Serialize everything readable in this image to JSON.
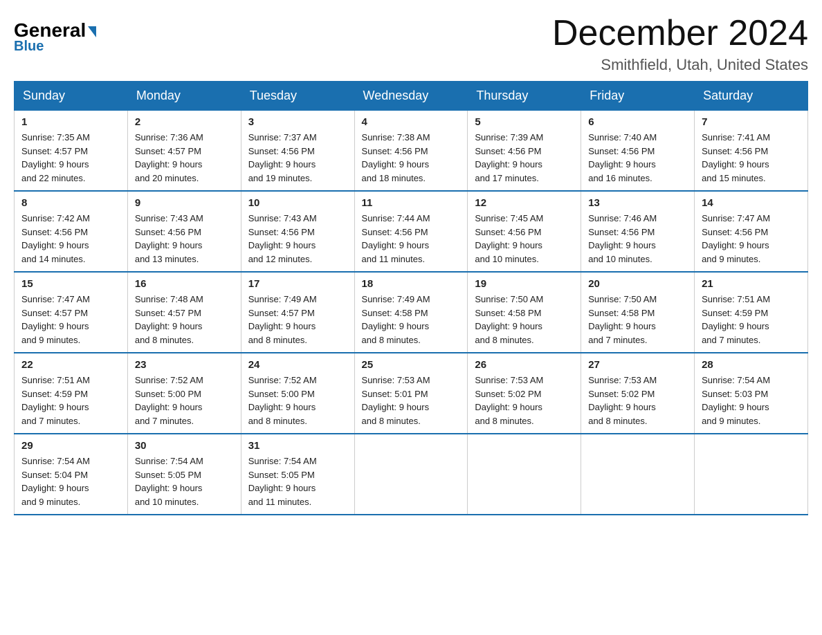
{
  "header": {
    "logo_general": "General",
    "logo_blue": "Blue",
    "month_title": "December 2024",
    "location": "Smithfield, Utah, United States"
  },
  "days_of_week": [
    "Sunday",
    "Monday",
    "Tuesday",
    "Wednesday",
    "Thursday",
    "Friday",
    "Saturday"
  ],
  "weeks": [
    [
      {
        "day": "1",
        "sunrise": "7:35 AM",
        "sunset": "4:57 PM",
        "daylight": "9 hours and 22 minutes."
      },
      {
        "day": "2",
        "sunrise": "7:36 AM",
        "sunset": "4:57 PM",
        "daylight": "9 hours and 20 minutes."
      },
      {
        "day": "3",
        "sunrise": "7:37 AM",
        "sunset": "4:56 PM",
        "daylight": "9 hours and 19 minutes."
      },
      {
        "day": "4",
        "sunrise": "7:38 AM",
        "sunset": "4:56 PM",
        "daylight": "9 hours and 18 minutes."
      },
      {
        "day": "5",
        "sunrise": "7:39 AM",
        "sunset": "4:56 PM",
        "daylight": "9 hours and 17 minutes."
      },
      {
        "day": "6",
        "sunrise": "7:40 AM",
        "sunset": "4:56 PM",
        "daylight": "9 hours and 16 minutes."
      },
      {
        "day": "7",
        "sunrise": "7:41 AM",
        "sunset": "4:56 PM",
        "daylight": "9 hours and 15 minutes."
      }
    ],
    [
      {
        "day": "8",
        "sunrise": "7:42 AM",
        "sunset": "4:56 PM",
        "daylight": "9 hours and 14 minutes."
      },
      {
        "day": "9",
        "sunrise": "7:43 AM",
        "sunset": "4:56 PM",
        "daylight": "9 hours and 13 minutes."
      },
      {
        "day": "10",
        "sunrise": "7:43 AM",
        "sunset": "4:56 PM",
        "daylight": "9 hours and 12 minutes."
      },
      {
        "day": "11",
        "sunrise": "7:44 AM",
        "sunset": "4:56 PM",
        "daylight": "9 hours and 11 minutes."
      },
      {
        "day": "12",
        "sunrise": "7:45 AM",
        "sunset": "4:56 PM",
        "daylight": "9 hours and 10 minutes."
      },
      {
        "day": "13",
        "sunrise": "7:46 AM",
        "sunset": "4:56 PM",
        "daylight": "9 hours and 10 minutes."
      },
      {
        "day": "14",
        "sunrise": "7:47 AM",
        "sunset": "4:56 PM",
        "daylight": "9 hours and 9 minutes."
      }
    ],
    [
      {
        "day": "15",
        "sunrise": "7:47 AM",
        "sunset": "4:57 PM",
        "daylight": "9 hours and 9 minutes."
      },
      {
        "day": "16",
        "sunrise": "7:48 AM",
        "sunset": "4:57 PM",
        "daylight": "9 hours and 8 minutes."
      },
      {
        "day": "17",
        "sunrise": "7:49 AM",
        "sunset": "4:57 PM",
        "daylight": "9 hours and 8 minutes."
      },
      {
        "day": "18",
        "sunrise": "7:49 AM",
        "sunset": "4:58 PM",
        "daylight": "9 hours and 8 minutes."
      },
      {
        "day": "19",
        "sunrise": "7:50 AM",
        "sunset": "4:58 PM",
        "daylight": "9 hours and 8 minutes."
      },
      {
        "day": "20",
        "sunrise": "7:50 AM",
        "sunset": "4:58 PM",
        "daylight": "9 hours and 7 minutes."
      },
      {
        "day": "21",
        "sunrise": "7:51 AM",
        "sunset": "4:59 PM",
        "daylight": "9 hours and 7 minutes."
      }
    ],
    [
      {
        "day": "22",
        "sunrise": "7:51 AM",
        "sunset": "4:59 PM",
        "daylight": "9 hours and 7 minutes."
      },
      {
        "day": "23",
        "sunrise": "7:52 AM",
        "sunset": "5:00 PM",
        "daylight": "9 hours and 7 minutes."
      },
      {
        "day": "24",
        "sunrise": "7:52 AM",
        "sunset": "5:00 PM",
        "daylight": "9 hours and 8 minutes."
      },
      {
        "day": "25",
        "sunrise": "7:53 AM",
        "sunset": "5:01 PM",
        "daylight": "9 hours and 8 minutes."
      },
      {
        "day": "26",
        "sunrise": "7:53 AM",
        "sunset": "5:02 PM",
        "daylight": "9 hours and 8 minutes."
      },
      {
        "day": "27",
        "sunrise": "7:53 AM",
        "sunset": "5:02 PM",
        "daylight": "9 hours and 8 minutes."
      },
      {
        "day": "28",
        "sunrise": "7:54 AM",
        "sunset": "5:03 PM",
        "daylight": "9 hours and 9 minutes."
      }
    ],
    [
      {
        "day": "29",
        "sunrise": "7:54 AM",
        "sunset": "5:04 PM",
        "daylight": "9 hours and 9 minutes."
      },
      {
        "day": "30",
        "sunrise": "7:54 AM",
        "sunset": "5:05 PM",
        "daylight": "9 hours and 10 minutes."
      },
      {
        "day": "31",
        "sunrise": "7:54 AM",
        "sunset": "5:05 PM",
        "daylight": "9 hours and 11 minutes."
      },
      null,
      null,
      null,
      null
    ]
  ],
  "labels": {
    "sunrise_prefix": "Sunrise: ",
    "sunset_prefix": "Sunset: ",
    "daylight_prefix": "Daylight: "
  }
}
